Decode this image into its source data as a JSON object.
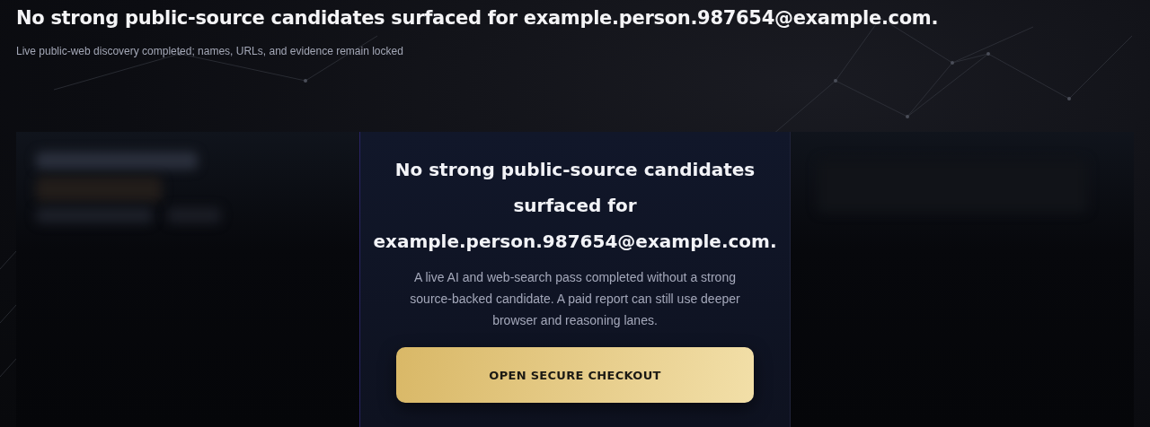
{
  "header": {
    "title": "No strong public-source candidates surfaced for example.person.987654@example.com.",
    "subtitle": "Live public-web discovery completed; names, URLs, and evidence remain locked"
  },
  "side_panels": [
    {
      "kind": "blurred"
    },
    {
      "kind": "blurred"
    }
  ],
  "result_card": {
    "title": "No strong public-source candidates surfaced for example.person.987654@example.com.",
    "body": "A live AI and web-search pass completed without a strong source-backed candidate. A paid report can still use deeper browser and reasoning lanes.",
    "button": "OPEN SECURE CHECKOUT"
  }
}
